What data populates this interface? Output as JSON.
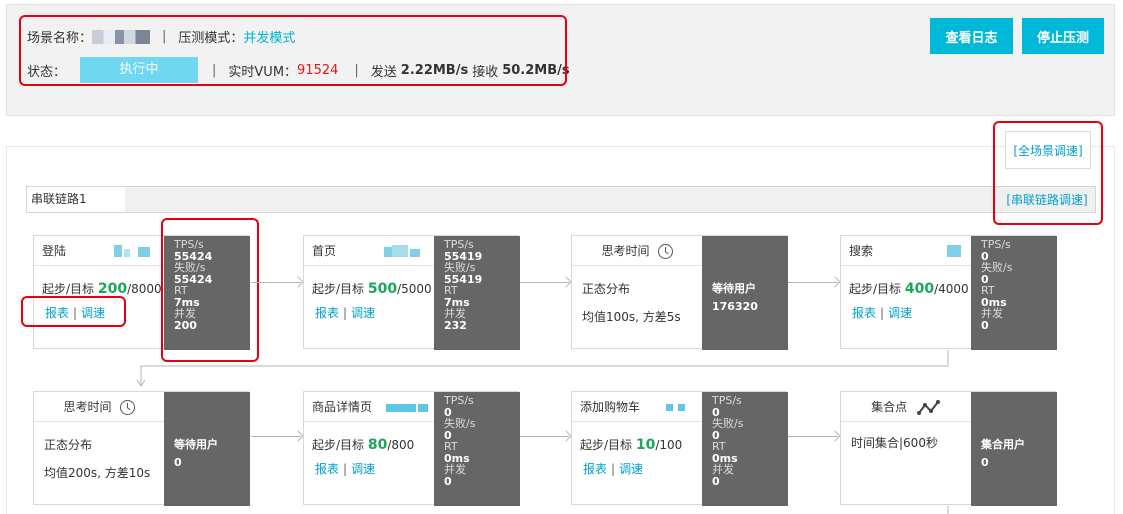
{
  "header": {
    "scene_label": "场景名称：",
    "mode_label": "压测模式：",
    "mode_value": "并发模式",
    "state_label": "状态：",
    "state_value": "执行中",
    "vum_label": "实时VUM：",
    "vum_value": "91524",
    "send_label": "发送",
    "send_value": "2.22MB/s",
    "recv_label": "接收",
    "recv_value": "50.2MB/s",
    "log_button": "查看日志",
    "stop_button": "停止压测"
  },
  "panel": {
    "all_scene_speed": "[全场景调速]",
    "chain_speed": "[串联链路调速]",
    "chain_name": "串联链路1"
  },
  "labels": {
    "tps": "TPS/s",
    "fail": "失败/s",
    "rt": "RT",
    "concurrency": "并发",
    "target": "起步/目标",
    "report": "报表",
    "speed": "调速",
    "wait_users": "等待用户",
    "sync_users": "集合用户",
    "dist": "正态分布"
  },
  "nodes": {
    "login": {
      "title": "登陆",
      "target": "200",
      "target_max": "/8000",
      "tps": "55424",
      "fail": "55424",
      "rt": "7ms",
      "conc": "200"
    },
    "home": {
      "title": "首页",
      "target": "500",
      "target_max": "/5000",
      "tps": "55419",
      "fail": "55419",
      "rt": "7ms",
      "conc": "232"
    },
    "think1": {
      "title": "思考时间",
      "desc": "均值100s, 方差5s",
      "wait": "176320"
    },
    "search": {
      "title": "搜索",
      "target": "400",
      "target_max": "/4000",
      "tps": "0",
      "fail": "0",
      "rt": "0ms",
      "conc": "0"
    },
    "think2": {
      "title": "思考时间",
      "desc": "均值200s, 方差10s",
      "wait": "0"
    },
    "detail": {
      "title": "商品详情页",
      "target": "80",
      "target_max": "/800",
      "tps": "0",
      "fail": "0",
      "rt": "0ms",
      "conc": "0"
    },
    "cart": {
      "title": "添加购物车",
      "target": "10",
      "target_max": "/100",
      "tps": "0",
      "fail": "0",
      "rt": "0ms",
      "conc": "0"
    },
    "sync": {
      "title": "集合点",
      "desc": "时间集合|600秒",
      "users": "0"
    }
  },
  "colors": {
    "accent": "#00b8d8",
    "highlight_border": "#e60012",
    "stats_panel": "#666666",
    "target_green": "#19a85a",
    "vum_red": "#e0171b"
  }
}
